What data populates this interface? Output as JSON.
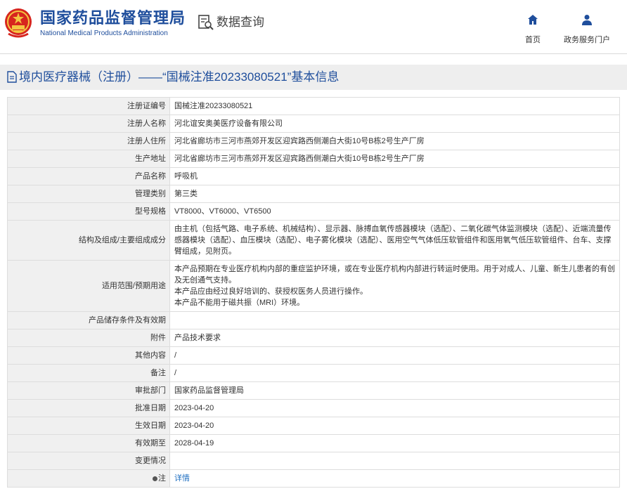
{
  "header": {
    "site_name_cn": "国家药品监督管理局",
    "site_name_en": "National Medical Products Administration",
    "query_label": "数据查询",
    "nav_home": "首页",
    "nav_portal": "政务服务门户"
  },
  "page_title": "境内医疗器械（注册）——“国械注准20233080521”基本信息",
  "rows": [
    {
      "label": "注册证编号",
      "value": "国械注准20233080521"
    },
    {
      "label": "注册人名称",
      "value": "河北谊安奥美医疗设备有限公司"
    },
    {
      "label": "注册人住所",
      "value": "河北省廊坊市三河市燕郊开发区迎宾路西侧潮白大街10号B栋2号生产厂房"
    },
    {
      "label": "生产地址",
      "value": "河北省廊坊市三河市燕郊开发区迎宾路西侧潮白大街10号B栋2号生产厂房"
    },
    {
      "label": "产品名称",
      "value": "呼吸机"
    },
    {
      "label": "管理类别",
      "value": "第三类"
    },
    {
      "label": "型号规格",
      "value": "VT8000、VT6000、VT6500"
    },
    {
      "label": "结构及组成/主要组成成分",
      "value": "由主机（包括气路、电子系统、机械结构）、显示器、脉搏血氧传感器模块（选配）、二氧化碳气体监测模块（选配）、近端流量传感器模块（选配）、血压模块（选配）、电子雾化模块（选配）、医用空气气体低压软管组件和医用氧气低压软管组件、台车、支撑臂组成，见附页。"
    },
    {
      "label": "适用范围/预期用途",
      "value": "本产品预期在专业医疗机构内部的重症监护环境，或在专业医疗机构内部进行转运时使用。用于对成人、儿童、新生儿患者的有创及无创通气支持。\n本产品应由经过良好培训的、获授权医务人员进行操作。\n本产品不能用于磁共振（MRI）环境。"
    },
    {
      "label": "产品储存条件及有效期",
      "value": ""
    },
    {
      "label": "附件",
      "value": "产品技术要求"
    },
    {
      "label": "其他内容",
      "value": "/"
    },
    {
      "label": "备注",
      "value": "/"
    },
    {
      "label": "审批部门",
      "value": "国家药品监督管理局"
    },
    {
      "label": "批准日期",
      "value": "2023-04-20"
    },
    {
      "label": "生效日期",
      "value": "2023-04-20"
    },
    {
      "label": "有效期至",
      "value": "2028-04-19"
    },
    {
      "label": "变更情况",
      "value": ""
    },
    {
      "label": "注",
      "value": "详情"
    }
  ],
  "icons": {
    "emblem": "national-emblem-icon",
    "query": "document-search-icon",
    "home": "home-icon",
    "portal": "user-icon",
    "title": "document-icon",
    "note": "dot-icon"
  },
  "colors": {
    "brand_blue": "#1f4e9c",
    "link_blue": "#1f6fc1",
    "label_bg": "#f0f0f0",
    "title_bar_bg": "#eeeeee"
  }
}
